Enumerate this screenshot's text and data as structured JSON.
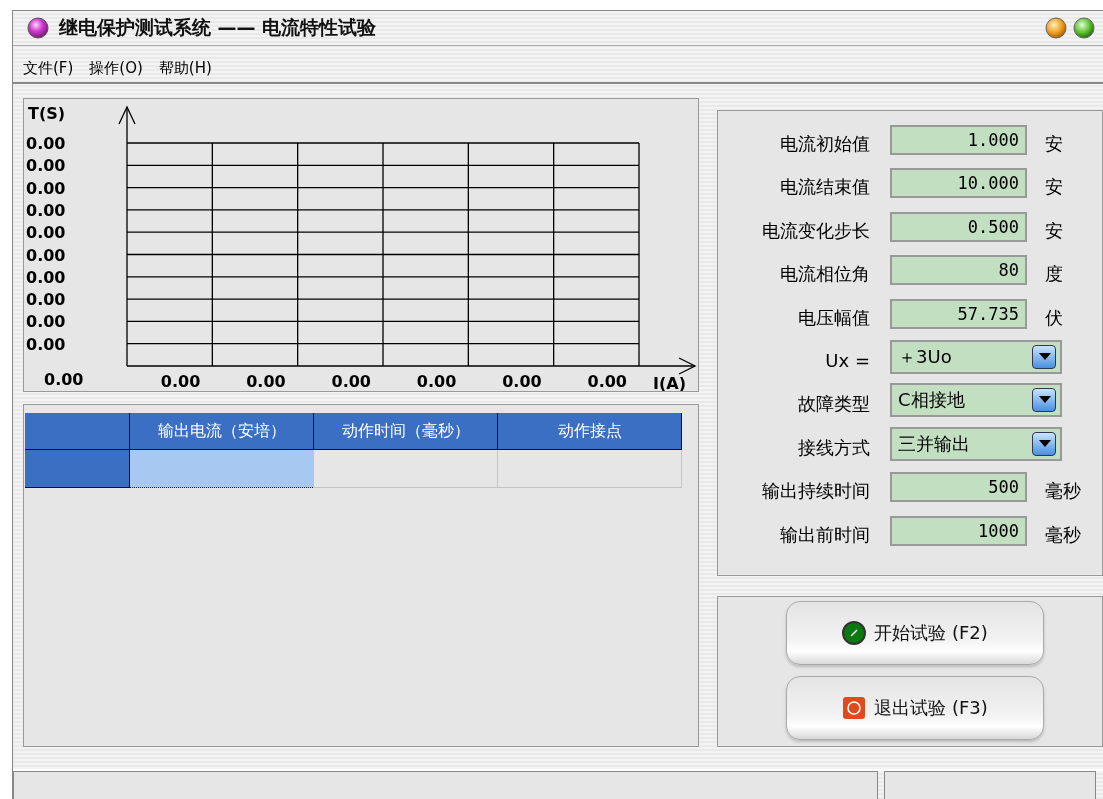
{
  "window": {
    "title": "继电保护测试系统 —— 电流特性试验"
  },
  "menu": [
    "文件(F)",
    "操作(O)",
    "帮助(H)"
  ],
  "chart": {
    "ylabel": "T(S)",
    "xlabel": "I(A)",
    "origin_label": "0.00",
    "y_tick_labels": [
      "0.00",
      "0.00",
      "0.00",
      "0.00",
      "0.00",
      "0.00",
      "0.00",
      "0.00",
      "0.00",
      "0.00"
    ],
    "x_tick_labels": [
      "0.00",
      "0.00",
      "0.00",
      "0.00",
      "0.00",
      "0.00"
    ]
  },
  "table": {
    "columns": [
      "输出电流（安培）",
      "动作时间（毫秒）",
      "动作接点"
    ],
    "rows": [
      {
        "cells": [
          {
            "selected": true
          },
          {
            "selected": false
          },
          {
            "selected": false
          }
        ]
      }
    ]
  },
  "params": [
    {
      "kind": "number",
      "label": "电流初始值",
      "value": "1.000",
      "unit": "安"
    },
    {
      "kind": "number",
      "label": "电流结束值",
      "value": "10.000",
      "unit": "安"
    },
    {
      "kind": "number",
      "label": "电流变化步长",
      "value": "0.500",
      "unit": "安"
    },
    {
      "kind": "number",
      "label": "电流相位角",
      "value": "80",
      "unit": "度"
    },
    {
      "kind": "number",
      "label": "电压幅值",
      "value": "57.735",
      "unit": "伏"
    },
    {
      "kind": "select",
      "label": "Ux =",
      "value": "＋3Uo"
    },
    {
      "kind": "select",
      "label": "故障类型",
      "value": "C相接地"
    },
    {
      "kind": "select",
      "label": "接线方式",
      "value": "三并输出"
    },
    {
      "kind": "number",
      "label": "输出持续时间",
      "value": "500",
      "unit": "毫秒"
    },
    {
      "kind": "number",
      "label": "输出前时间",
      "value": "1000",
      "unit": "毫秒"
    }
  ],
  "buttons": [
    {
      "kind": "start",
      "label": "开始试验 (F2)"
    },
    {
      "kind": "exit",
      "label": "退出试验 (F3)"
    }
  ]
}
